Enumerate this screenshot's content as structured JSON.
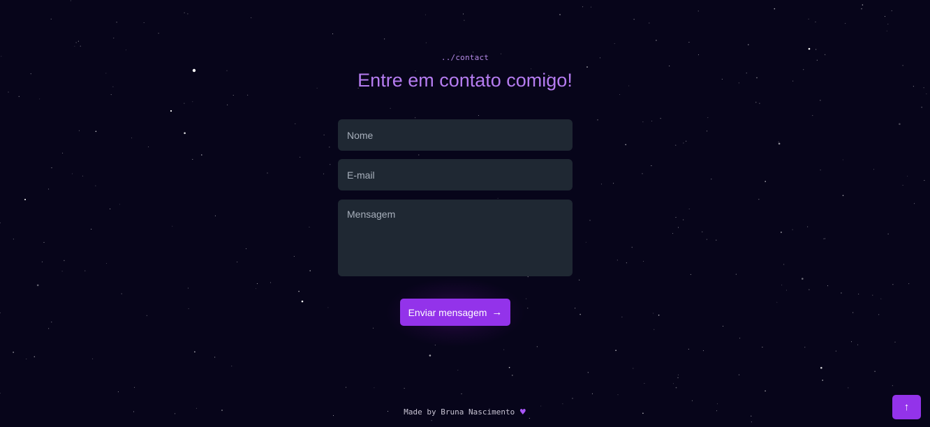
{
  "breadcrumb": "../contact",
  "title": "Entre em contato comigo!",
  "form": {
    "name_placeholder": "Nome",
    "name_value": "",
    "email_placeholder": "E-mail",
    "email_value": "",
    "message_placeholder": "Mensagem",
    "message_value": ""
  },
  "submit": {
    "label": "Enviar mensagem",
    "icon": "arrow-right-icon",
    "icon_glyph": "→"
  },
  "footer": {
    "made_by": "Made by",
    "author": "Bruna Nascimento",
    "icon": "heart-icon",
    "icon_glyph": "♥"
  },
  "scroll_top": {
    "icon": "arrow-up-icon",
    "icon_glyph": "↑"
  },
  "colors": {
    "background": "#07051a",
    "accent": "#9333ea",
    "title": "#b57cf0",
    "field_bg": "#1f2833"
  }
}
